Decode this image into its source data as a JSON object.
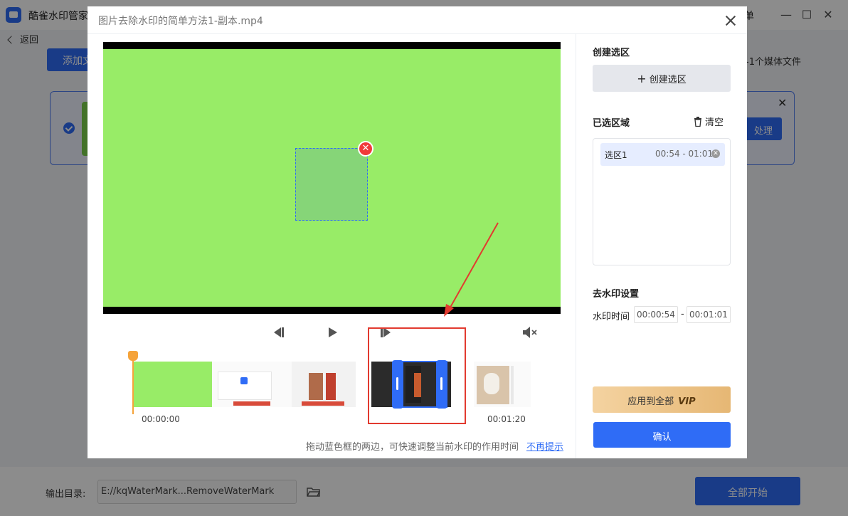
{
  "app": {
    "name": "酷雀水印管家",
    "back_label": "返回",
    "add_file_label": "添加文",
    "media_count_text": "-1个媒体文件",
    "menu_text": "单",
    "task_process_label": "处理",
    "output_label": "输出目录:",
    "output_path": "E://kqWaterMark...RemoveWaterMark",
    "start_all_label": "全部开始"
  },
  "dialog": {
    "title": "图片去除水印的简单方法1-副本.mp4",
    "timeline": {
      "start_time": "00:00:00",
      "end_time": "00:01:20",
      "hint": "拖动蓝色框的两边，可快速调整当前水印的作用时间",
      "hint_link": "不再提示"
    },
    "panel": {
      "create_region_title": "创建选区",
      "create_region_button": "创建选区",
      "selected_regions_title": "已选区域",
      "clear_label": "清空",
      "regions": [
        {
          "name": "选区1",
          "range": "00:54 - 01:01"
        }
      ],
      "settings_title": "去水印设置",
      "watermark_time_label": "水印时间",
      "time_from": "00:00:54",
      "time_to": "00:01:01",
      "apply_all_label": "应用到全部",
      "vip_label": "VIP",
      "confirm_label": "确认"
    }
  },
  "colors": {
    "accent": "#2f6cf6",
    "video_bg": "#98ec67",
    "playhead": "#f5a33a",
    "highlight_red": "#e23a2f"
  },
  "icons": [
    "back-arrow-icon",
    "close-icon",
    "folder-icon",
    "prev-frame-icon",
    "play-icon",
    "next-frame-icon",
    "mute-icon",
    "plus-icon",
    "trash-icon",
    "remove-icon"
  ]
}
